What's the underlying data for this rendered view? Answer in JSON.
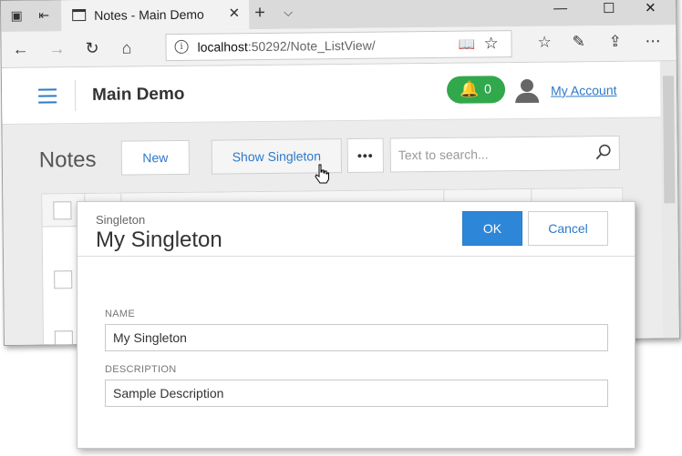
{
  "browser": {
    "tab_title": "Notes - Main Demo",
    "url_host": "localhost",
    "url_rest": ":50292/Note_ListView/"
  },
  "app": {
    "title": "Main Demo",
    "notification_count": "0",
    "account_link": "My Account"
  },
  "toolbar": {
    "heading": "Notes",
    "new_label": "New",
    "show_singleton_label": "Show Singleton",
    "more_label": "•••",
    "search_placeholder": "Text to search..."
  },
  "dialog": {
    "caption": "Singleton",
    "title": "My Singleton",
    "ok_label": "OK",
    "cancel_label": "Cancel",
    "fields": [
      {
        "label": "NAME",
        "value": "My Singleton"
      },
      {
        "label": "DESCRIPTION",
        "value": "Sample Description"
      }
    ]
  },
  "colors": {
    "accent": "#2e79c8",
    "ok_button": "#2e86d8",
    "notification_badge": "#31a84c"
  },
  "icons": {
    "menu": "hamburger-icon",
    "notification": "bell-icon",
    "user": "user-icon",
    "search": "search-icon"
  }
}
